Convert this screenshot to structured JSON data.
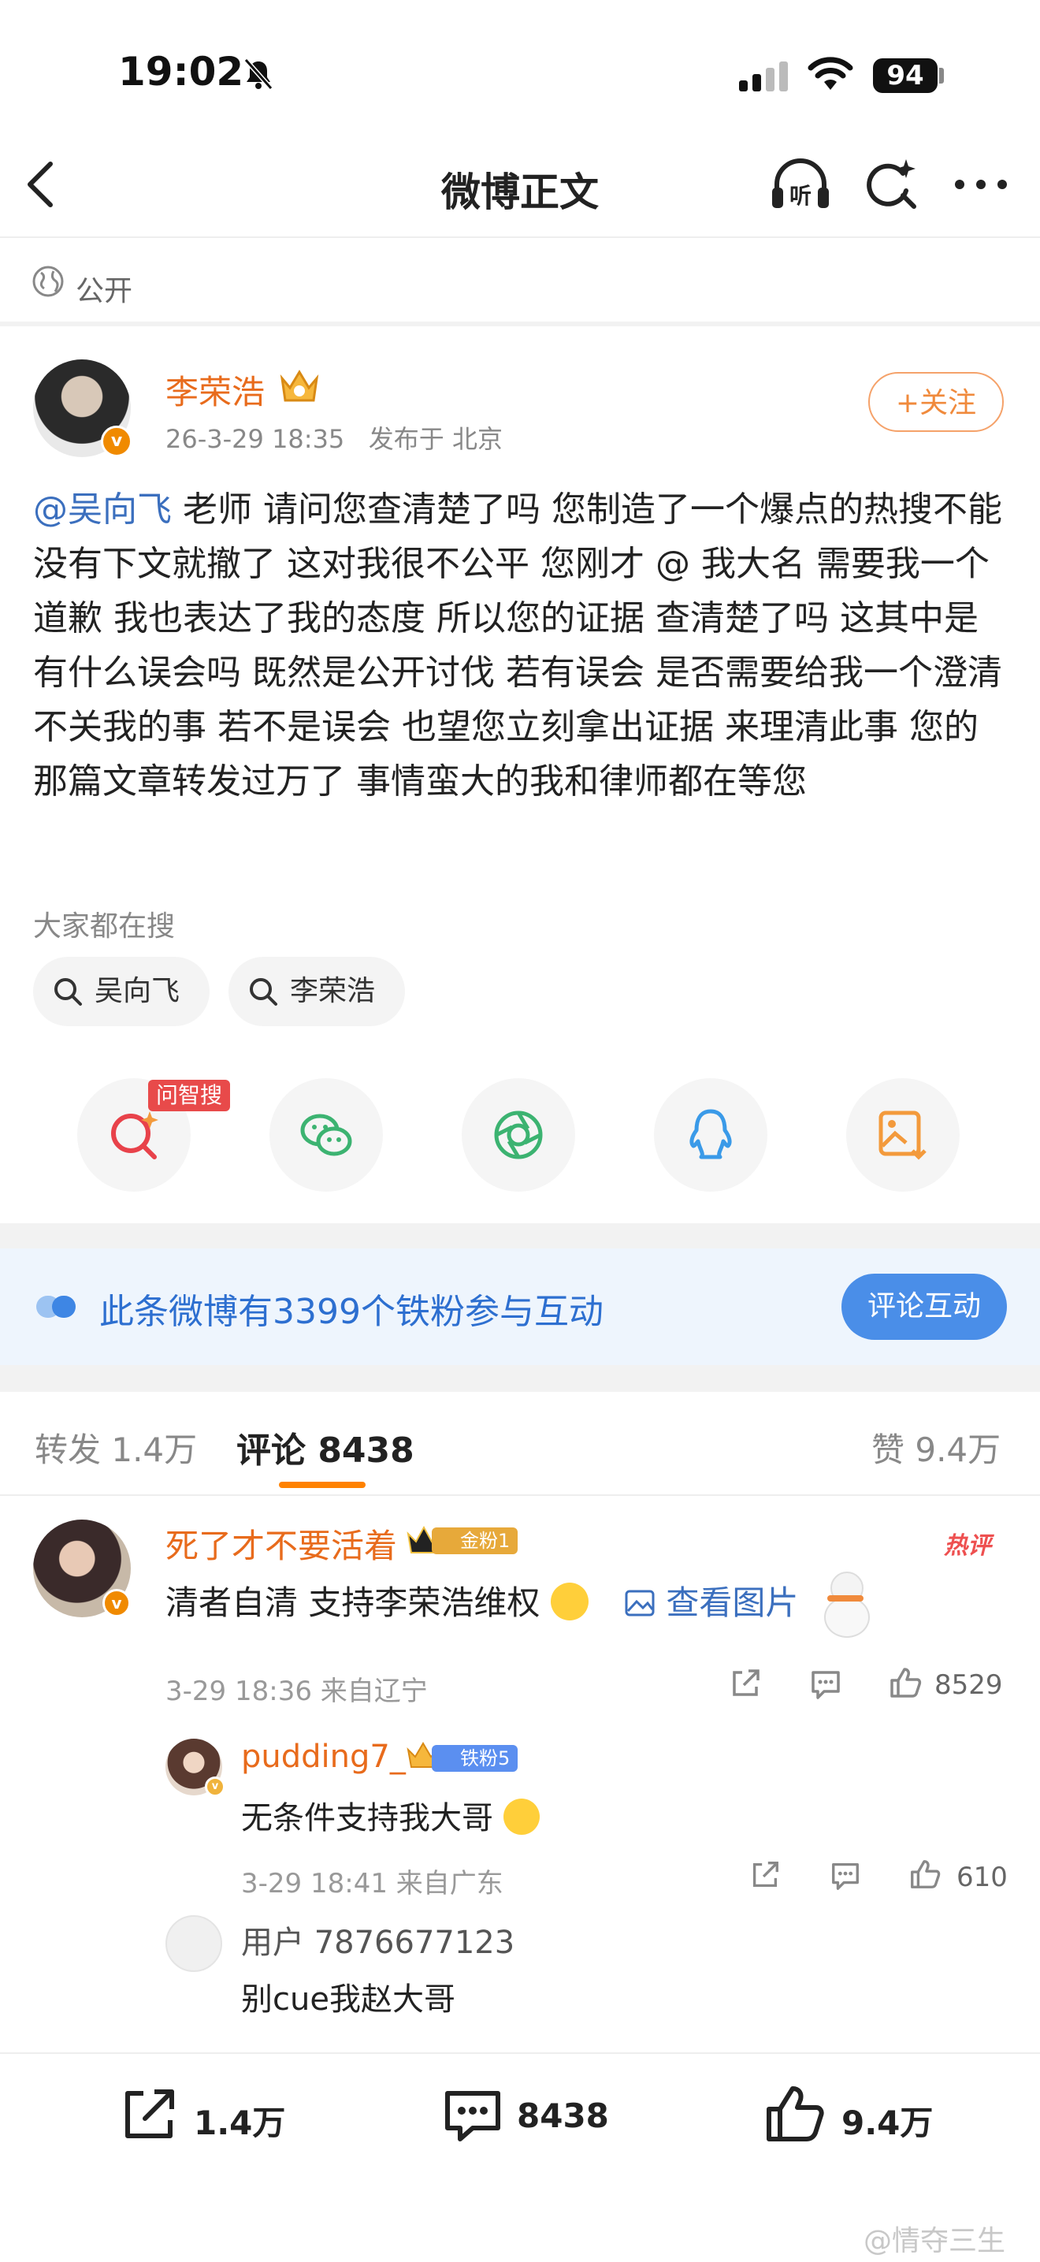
{
  "status_bar": {
    "time": "19:02",
    "battery": "94"
  },
  "nav": {
    "title": "微博正文",
    "listen_icon_text": "听"
  },
  "visibility": {
    "label": "公开"
  },
  "post": {
    "author": "李荣浩",
    "time": "26-3-29 18:35",
    "location": "发布于 北京",
    "follow_label": "+关注",
    "mention": "@吴向飞",
    "text": " 老师 请问您查清楚了吗 您制造了一个爆点的热搜不能没有下文就撤了 这对我很不公平 您刚才 @ 我大名 需要我一个道歉 我也表达了我的态度 所以您的证据 查清楚了吗 这其中是有什么误会吗 既然是公开讨伐 若有误会 是否需要给我一个澄清 不关我的事 若不是误会 也望您立刻拿出证据 来理清此事 您的那篇文章转发过万了 事情蛮大的我和律师都在等您"
  },
  "search": {
    "title": "大家都在搜",
    "chips": [
      "吴向飞",
      "李荣浩"
    ]
  },
  "share": {
    "ask_badge": "问智搜",
    "icons": [
      "zhisou-search-icon",
      "wechat-icon",
      "moments-icon",
      "qq-icon",
      "save-image-icon"
    ]
  },
  "fan_banner": {
    "text": "此条微博有3399个铁粉参与互动",
    "button": "评论互动"
  },
  "tabs": {
    "repost": "转发 1.4万",
    "comment": "评论 8438",
    "like": "赞 9.4万"
  },
  "comments": [
    {
      "name": "死了才不要活着",
      "fan_tag": "金粉1",
      "hot_tag": "热评",
      "text": "清者自清 支持李荣浩维权",
      "image_link": "查看图片",
      "meta": "3-29 18:36 来自辽宁",
      "likes": "8529"
    }
  ],
  "replies": [
    {
      "name": "pudding7_",
      "fan_tag": "铁粉5",
      "text": "无条件支持我大哥",
      "meta": "3-29 18:41 来自广东",
      "likes": "610"
    },
    {
      "name": "用户 7876677123",
      "text": "别cue我赵大哥"
    }
  ],
  "bottom_bar": {
    "repost": "1.4万",
    "comment": "8438",
    "like": "9.4万"
  },
  "watermark": "@情夺三生",
  "colors": {
    "accent_orange": "#ff8200",
    "name_orange": "#e86b1c",
    "link_blue": "#3b6fbe",
    "fan_blue": "#4a8ee8"
  }
}
